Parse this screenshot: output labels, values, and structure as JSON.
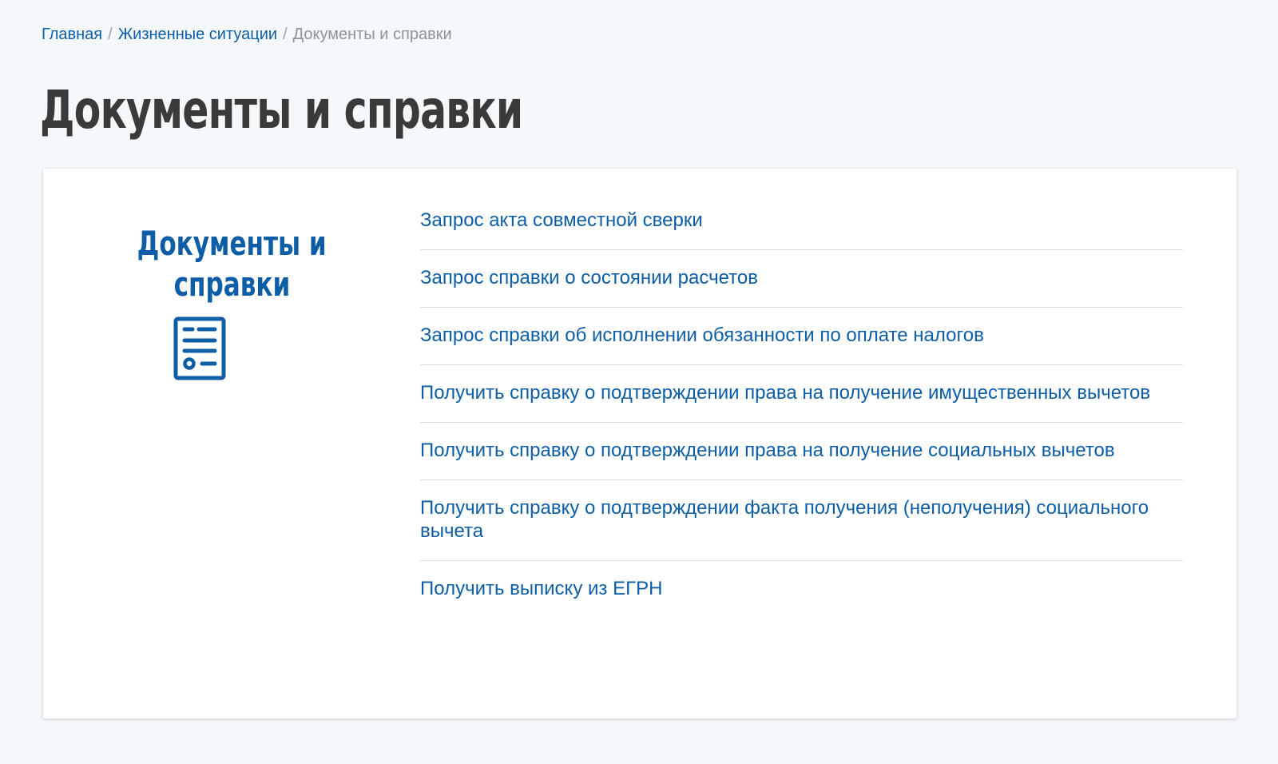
{
  "breadcrumb": {
    "home": "Главная",
    "situations": "Жизненные ситуации",
    "current": "Документы и справки",
    "separator": "/"
  },
  "page_title": "Документы и справки",
  "card": {
    "side_title_line1": "Документы и",
    "side_title_line2": "справки",
    "icon": "document-icon",
    "links": [
      "Запрос акта совместной сверки",
      "Запрос справки о состоянии расчетов",
      "Запрос справки об исполнении обязанности по оплате налогов",
      "Получить справку о подтверждении права на получение имущественных вычетов",
      "Получить справку о подтверждении права на получение социальных вычетов",
      "Получить справку о подтверждении факта получения (неполучения) социального вычета",
      "Получить выписку из ЕГРН"
    ]
  },
  "colors": {
    "accent": "#0d5ea6",
    "background": "#f4f8fb",
    "title": "#3a3a3a",
    "muted": "#8c949b"
  }
}
